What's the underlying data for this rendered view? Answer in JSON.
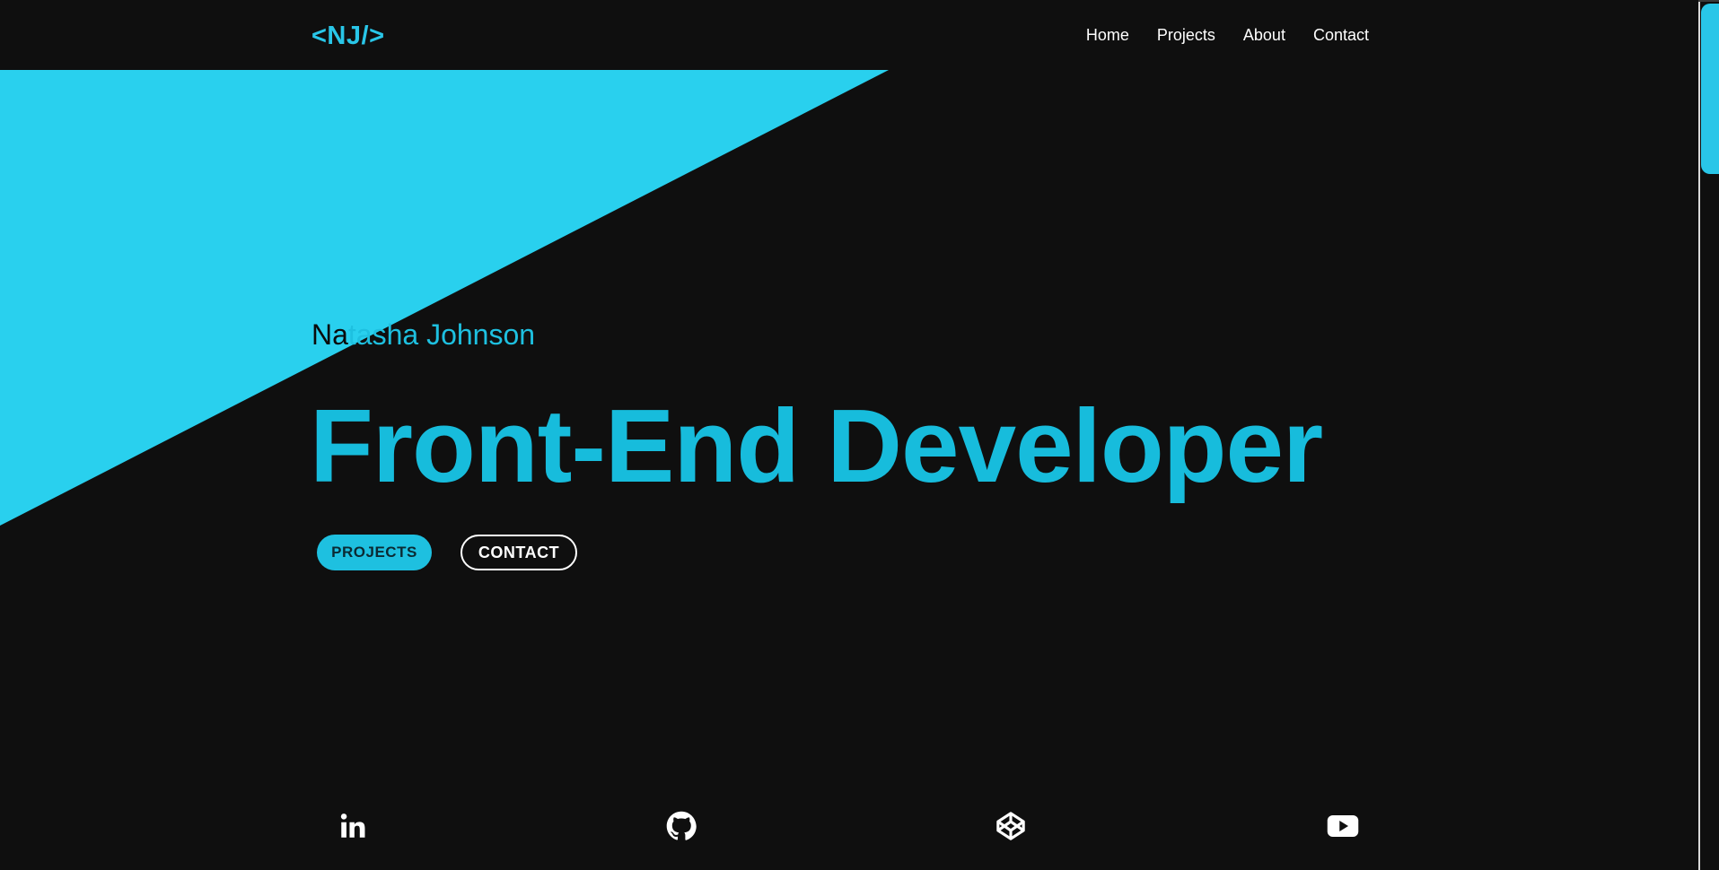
{
  "colors": {
    "background": "#0f0f0f",
    "accent": "#29c6e8",
    "text_light": "#ffffff"
  },
  "header": {
    "logo": "<NJ/>",
    "nav": [
      {
        "label": "Home"
      },
      {
        "label": "Projects"
      },
      {
        "label": "About"
      },
      {
        "label": "Contact"
      }
    ]
  },
  "hero": {
    "name_part1": "Na",
    "name_part2": "tasha Johnson",
    "title": "Front-End Developer",
    "buttons": {
      "projects": "PROJECTS",
      "contact": "CONTACT"
    }
  },
  "social": [
    {
      "icon": "linkedin-icon"
    },
    {
      "icon": "github-icon"
    },
    {
      "icon": "codepen-icon"
    },
    {
      "icon": "youtube-icon"
    }
  ]
}
